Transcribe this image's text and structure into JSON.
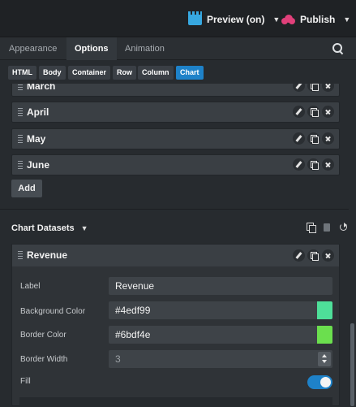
{
  "topbar": {
    "preview_label": "Preview (on)",
    "publish_label": "Publish",
    "preview_icon": "clapperboard-icon",
    "publish_icon": "cloud-upload-icon"
  },
  "tabs": [
    {
      "label": "Appearance"
    },
    {
      "label": "Options"
    },
    {
      "label": "Animation"
    }
  ],
  "breadcrumbs": [
    {
      "label": "HTML"
    },
    {
      "label": "Body"
    },
    {
      "label": "Container"
    },
    {
      "label": "Row"
    },
    {
      "label": "Column"
    },
    {
      "label": "Chart"
    }
  ],
  "labels_list": {
    "items": [
      {
        "label": "March"
      },
      {
        "label": "April"
      },
      {
        "label": "May"
      },
      {
        "label": "June"
      }
    ],
    "add_label": "Add"
  },
  "datasets": {
    "title": "Chart Datasets",
    "items": [
      {
        "label": "Revenue",
        "fields": {
          "label_label": "Label",
          "label_value": "Revenue",
          "bg_label": "Background Color",
          "bg_value": "#4edf99",
          "border_label": "Border Color",
          "border_value": "#6bdf4e",
          "width_label": "Border Width",
          "width_value": "3",
          "fill_label": "Fill",
          "fill_on": true
        }
      }
    ]
  },
  "colors": {
    "accent": "#1e82c9",
    "publish": "#e0407a",
    "preview": "#37a8e0"
  }
}
